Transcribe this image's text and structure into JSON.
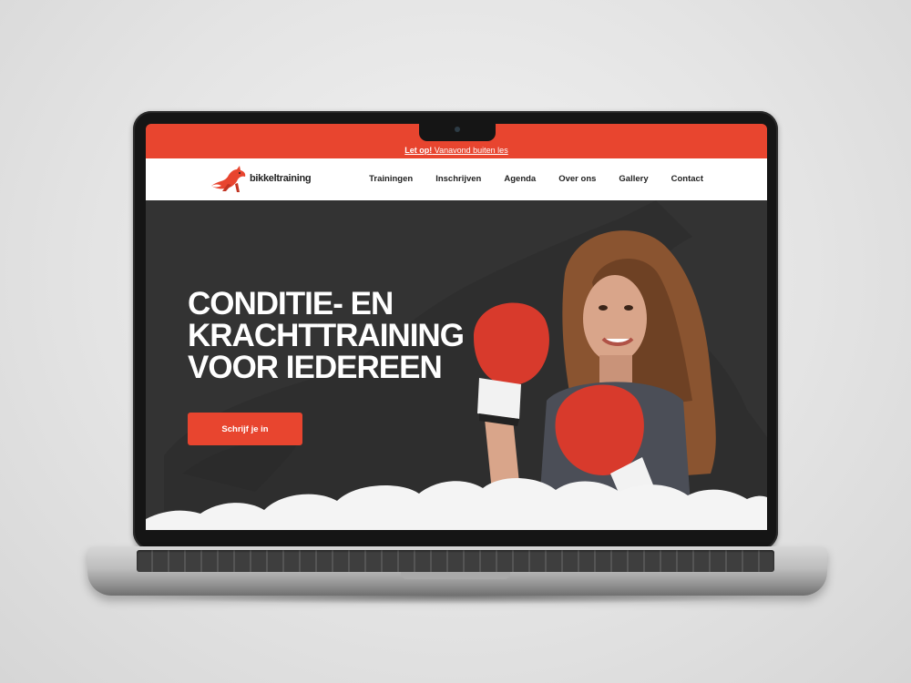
{
  "alert": {
    "prefix": "Let op!",
    "message": " Vanavond buiten les"
  },
  "brand": {
    "name": "bikkeltraining"
  },
  "nav": {
    "items": [
      "Trainingen",
      "Inschrijven",
      "Agenda",
      "Over ons",
      "Gallery",
      "Contact"
    ]
  },
  "hero": {
    "title_lines": [
      "CONDITIE- EN",
      "KRACHTTRAINING",
      "VOOR IEDEREEN"
    ],
    "cta_label": "Schrijf je in"
  },
  "colors": {
    "accent": "#e8452f",
    "hero_bg": "#333333",
    "nav_bg": "#ffffff"
  },
  "icons": {
    "logo": "fox-logo-icon",
    "hero_image": "boxer-woman-photo"
  }
}
